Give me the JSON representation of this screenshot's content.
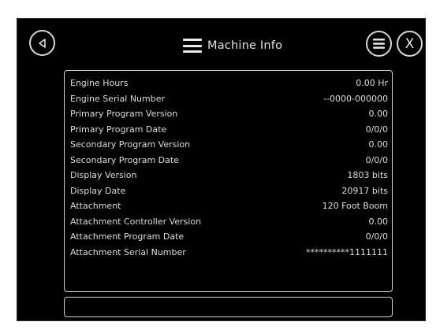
{
  "header": {
    "title": "Machine Info",
    "close_label": "X"
  },
  "icons": {
    "back": "back-arrow-icon",
    "menu": "menu-icon",
    "title": "hamburger-icon"
  },
  "rows": [
    {
      "label": "Engine Hours",
      "value": "0.00 Hr"
    },
    {
      "label": "Engine Serial Number",
      "value": "--0000-000000"
    },
    {
      "label": "Primary Program Version",
      "value": "0.00"
    },
    {
      "label": "Primary Program Date",
      "value": "0/0/0"
    },
    {
      "label": "Secondary Program Version",
      "value": "0.00"
    },
    {
      "label": "Secondary Program Date",
      "value": "0/0/0"
    },
    {
      "label": "Display Version",
      "value": "1803 bits"
    },
    {
      "label": "Display Date",
      "value": "20917 bits"
    },
    {
      "label": "Attachment",
      "value": "120 Foot Boom"
    },
    {
      "label": "Attachment Controller Version",
      "value": "0.00"
    },
    {
      "label": "Attachment Program Date",
      "value": "0/0/0"
    },
    {
      "label": "Attachment Serial Number",
      "value": "**********1111111"
    }
  ],
  "input": {
    "value": ""
  }
}
